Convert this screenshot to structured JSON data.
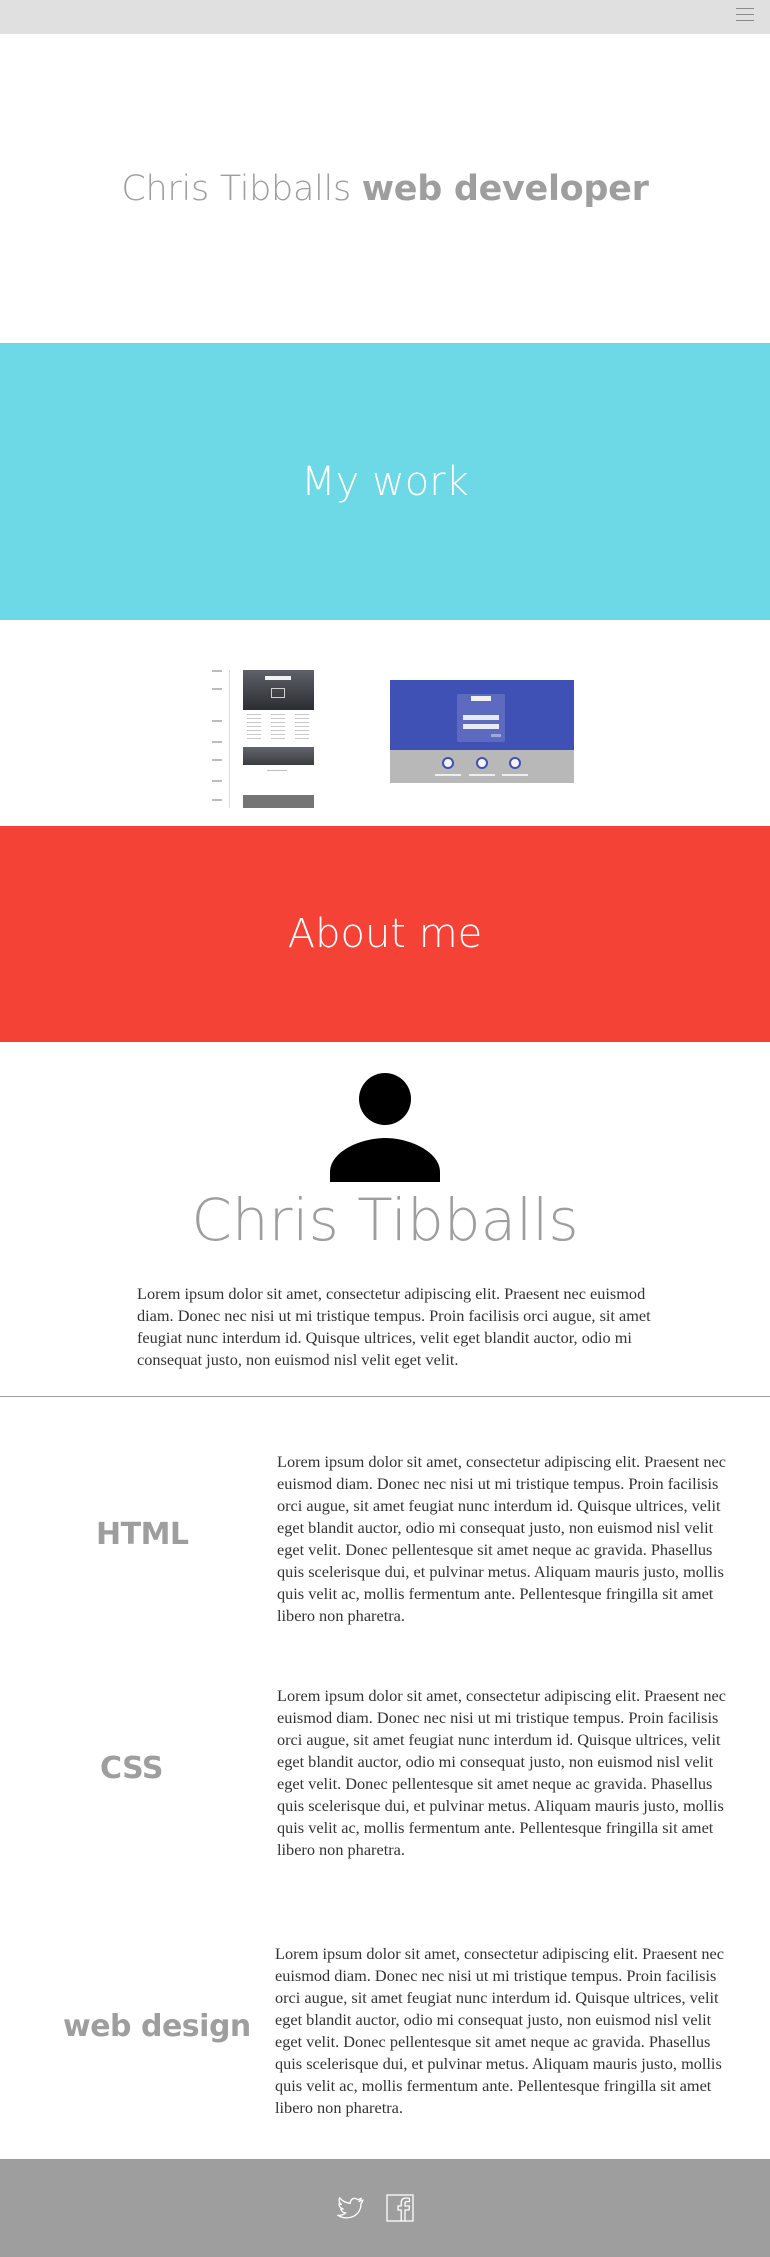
{
  "header": {
    "menu_icon": "hamburger-menu-icon"
  },
  "hero": {
    "name": "Chris Tibballs",
    "role": "web developer"
  },
  "sections": {
    "work_title": "My work",
    "about_title": "About me"
  },
  "work": {
    "thumbnails": [
      "login-page-mockup-thumbnail",
      "app-dashboard-mockup-thumbnail"
    ]
  },
  "about": {
    "avatar_icon": "person-icon",
    "name": "Chris Tibballs",
    "bio": "Lorem ipsum dolor sit amet, consectetur adipiscing elit. Praesent nec euismod diam. Donec nec nisi ut mi tristique tempus. Proin facilisis orci augue, sit amet feugiat nunc interdum id. Quisque ultrices, velit eget blandit auctor, odio mi consequat justo, non euismod nisl velit eget velit."
  },
  "skills": [
    {
      "title": "HTML",
      "text": "Lorem ipsum dolor sit amet, consectetur adipiscing elit. Praesent nec euismod diam. Donec nec nisi ut mi tristique tempus. Proin facilisis orci augue, sit amet feugiat nunc interdum id. Quisque ultrices, velit eget blandit auctor, odio mi consequat justo, non euismod nisl velit eget velit. Donec pellentesque sit amet neque ac gravida. Phasellus quis scelerisque dui, et pulvinar metus. Aliquam mauris justo, mollis quis velit ac, mollis fermentum ante. Pellentesque fringilla sit amet libero non pharetra."
    },
    {
      "title": "CSS",
      "text": "Lorem ipsum dolor sit amet, consectetur adipiscing elit. Praesent nec euismod diam. Donec nec nisi ut mi tristique tempus. Proin facilisis orci augue, sit amet feugiat nunc interdum id. Quisque ultrices, velit eget blandit auctor, odio mi consequat justo, non euismod nisl velit eget velit. Donec pellentesque sit amet neque ac gravida. Phasellus quis scelerisque dui, et pulvinar metus. Aliquam mauris justo, mollis quis velit ac, mollis fermentum ante. Pellentesque fringilla sit amet libero non pharetra."
    },
    {
      "title": "web design",
      "text": "Lorem ipsum dolor sit amet, consectetur adipiscing elit. Praesent nec euismod diam. Donec nec nisi ut mi tristique tempus. Proin facilisis orci augue, sit amet feugiat nunc interdum id. Quisque ultrices, velit eget blandit auctor, odio mi consequat justo, non euismod nisl velit eget velit. Donec pellentesque sit amet neque ac gravida. Phasellus quis scelerisque dui, et pulvinar metus. Aliquam mauris justo, mollis quis velit ac, mollis fermentum ante. Pellentesque fringilla sit amet libero non pharetra."
    }
  ],
  "footer": {
    "icons": [
      "twitter-icon",
      "facebook-icon"
    ]
  },
  "colors": {
    "work_band": "#6dd9e6",
    "about_band": "#f44336",
    "footer": "#9e9e9e",
    "topbar": "#e0e0e0",
    "heading_gray": "#9e9e9e"
  }
}
